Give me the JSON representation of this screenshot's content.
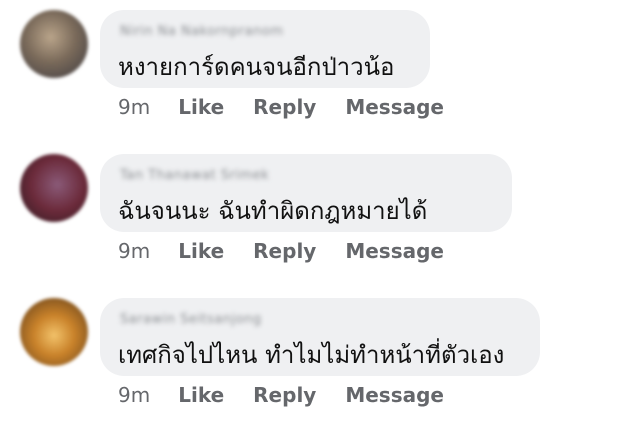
{
  "comments": [
    {
      "author": "Nirin Na Nakornpranom",
      "text": "หงายการ์ดคนจนอีกป่าวน้อ",
      "time": "9m",
      "avatar_color": "#7a6a5a"
    },
    {
      "author": "Tan Thanawat Srimek",
      "text": "ฉันจนนะ ฉันทำผิดกฎหมายได้",
      "time": "9m",
      "avatar_color": "#6b2a3a"
    },
    {
      "author": "Sarawin Seitsanjong",
      "text": "เทศกิจไปไหน ทำไมไม่ทำหน้าที่ตัวเอง",
      "time": "9m",
      "avatar_color": "#c9822a"
    }
  ],
  "actions": {
    "like": "Like",
    "reply": "Reply",
    "message": "Message"
  }
}
